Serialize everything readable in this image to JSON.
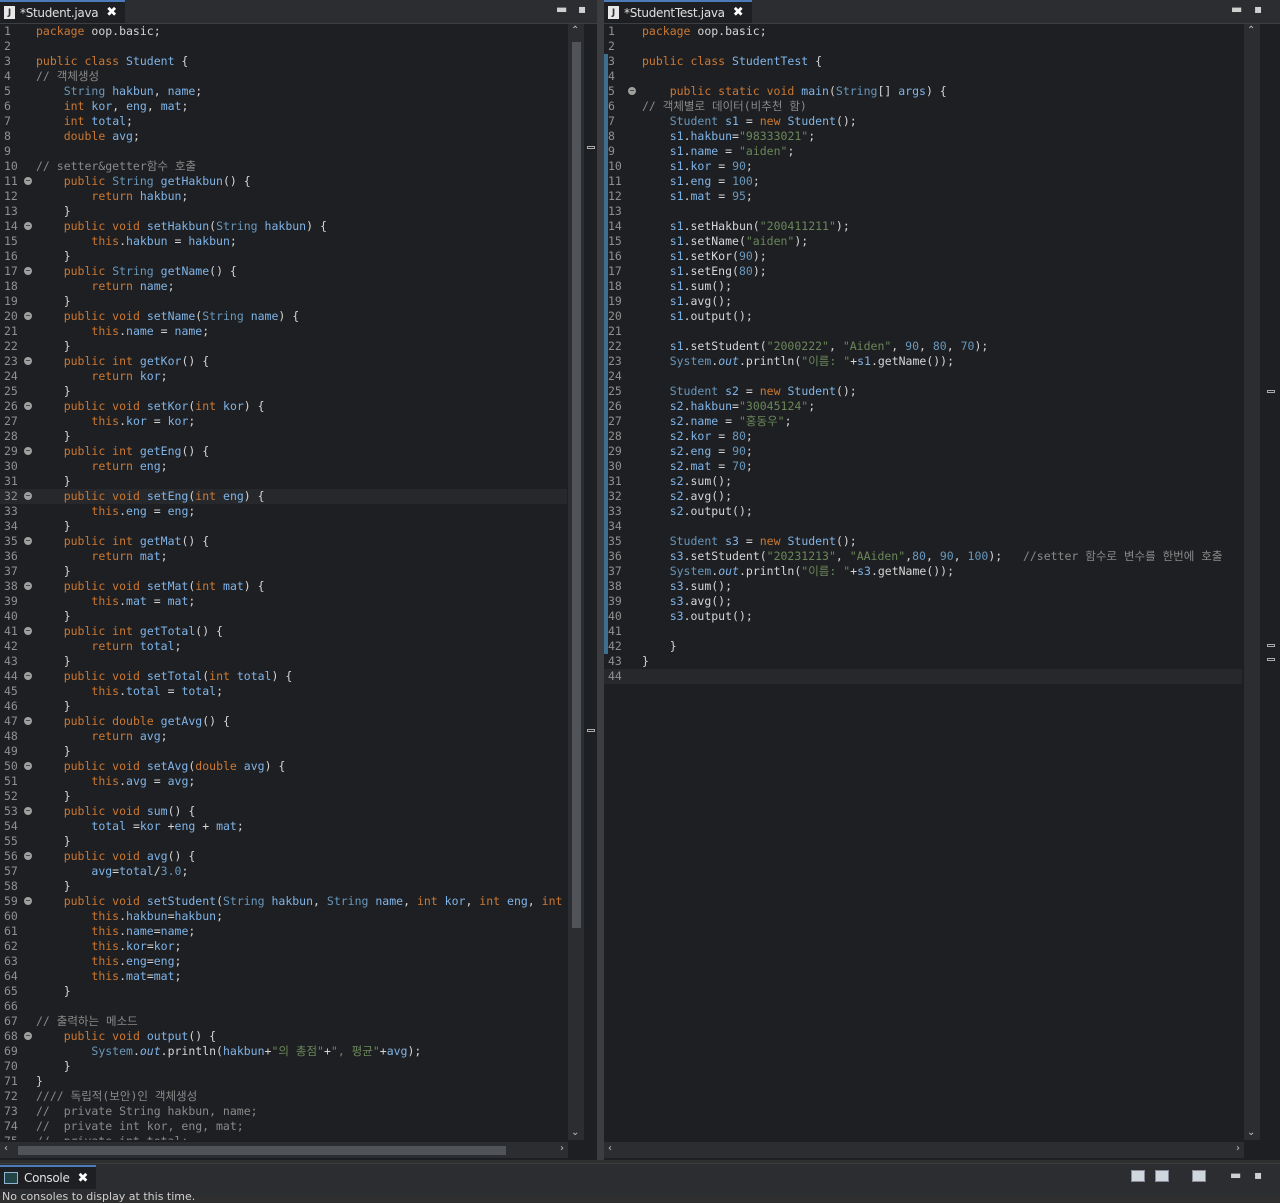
{
  "left_editor": {
    "tab_title": "*Student.java",
    "file_icon": "J",
    "lines": [
      {
        "n": "1",
        "html": "<span class='kw'>package</span> oop.basic;"
      },
      {
        "n": "2",
        "html": ""
      },
      {
        "n": "3",
        "html": "<span class='kw'>public class</span> <span class='fn'>Student</span> {"
      },
      {
        "n": "4",
        "html": "<span class='cm'>// 객체생성</span>"
      },
      {
        "n": "5",
        "html": "    <span class='ty'>String</span> <span class='fn'>hakbun</span>, <span class='fn'>name</span>;"
      },
      {
        "n": "6",
        "html": "    <span class='kw'>int</span> <span class='fn'>kor</span>, <span class='fn'>eng</span>, <span class='fn'>mat</span>;"
      },
      {
        "n": "7",
        "html": "    <span class='kw'>int</span> <span class='fn'>total</span>;"
      },
      {
        "n": "8",
        "html": "    <span class='kw'>double</span> <span class='fn'>avg</span>;"
      },
      {
        "n": "9",
        "html": ""
      },
      {
        "n": "10",
        "html": "<span class='cm'>// setter&amp;getter함수 호출</span>"
      },
      {
        "n": "11",
        "fold": true,
        "html": "    <span class='kw'>public</span> <span class='ty'>String</span> <span class='fn'>getHakbun</span>() {"
      },
      {
        "n": "12",
        "html": "        <span class='kw'>return</span> <span class='fn'>hakbun</span>;"
      },
      {
        "n": "13",
        "html": "    }"
      },
      {
        "n": "14",
        "fold": true,
        "html": "    <span class='kw'>public void</span> <span class='fn'>setHakbun</span>(<span class='ty'>String</span> <span class='fn'>hakbun</span>) {"
      },
      {
        "n": "15",
        "html": "        <span class='kw'>this</span>.<span class='fn'>hakbun</span> = <span class='fn'>hakbun</span>;"
      },
      {
        "n": "16",
        "html": "    }"
      },
      {
        "n": "17",
        "fold": true,
        "html": "    <span class='kw'>public</span> <span class='ty'>String</span> <span class='fn'>getName</span>() {"
      },
      {
        "n": "18",
        "html": "        <span class='kw'>return</span> <span class='fn'>name</span>;"
      },
      {
        "n": "19",
        "html": "    }"
      },
      {
        "n": "20",
        "fold": true,
        "html": "    <span class='kw'>public void</span> <span class='fn'>setName</span>(<span class='ty'>String</span> <span class='fn'>name</span>) {"
      },
      {
        "n": "21",
        "html": "        <span class='kw'>this</span>.<span class='fn'>name</span> = <span class='fn'>name</span>;"
      },
      {
        "n": "22",
        "html": "    }"
      },
      {
        "n": "23",
        "fold": true,
        "html": "    <span class='kw'>public int</span> <span class='fn'>getKor</span>() {"
      },
      {
        "n": "24",
        "html": "        <span class='kw'>return</span> <span class='fn'>kor</span>;"
      },
      {
        "n": "25",
        "html": "    }"
      },
      {
        "n": "26",
        "fold": true,
        "html": "    <span class='kw'>public void</span> <span class='fn'>setKor</span>(<span class='kw'>int</span> <span class='fn'>kor</span>) {"
      },
      {
        "n": "27",
        "html": "        <span class='kw'>this</span>.<span class='fn'>kor</span> = <span class='fn'>kor</span>;"
      },
      {
        "n": "28",
        "html": "    }"
      },
      {
        "n": "29",
        "fold": true,
        "html": "    <span class='kw'>public int</span> <span class='fn'>getEng</span>() {"
      },
      {
        "n": "30",
        "html": "        <span class='kw'>return</span> <span class='fn'>eng</span>;"
      },
      {
        "n": "31",
        "html": "    }"
      },
      {
        "n": "32",
        "fold": true,
        "cur": true,
        "html": "    <span class='kw'>public void</span> <span class='fn'>setEng</span>(<span class='kw'>int</span> <span class='fn'>eng</span>) {"
      },
      {
        "n": "33",
        "html": "        <span class='kw'>this</span>.<span class='fn'>eng</span> = <span class='fn'>eng</span>;"
      },
      {
        "n": "34",
        "html": "    }"
      },
      {
        "n": "35",
        "fold": true,
        "html": "    <span class='kw'>public int</span> <span class='fn'>getMat</span>() {"
      },
      {
        "n": "36",
        "html": "        <span class='kw'>return</span> <span class='fn'>mat</span>;"
      },
      {
        "n": "37",
        "html": "    }"
      },
      {
        "n": "38",
        "fold": true,
        "html": "    <span class='kw'>public void</span> <span class='fn'>setMat</span>(<span class='kw'>int</span> <span class='fn'>mat</span>) {"
      },
      {
        "n": "39",
        "html": "        <span class='kw'>this</span>.<span class='fn'>mat</span> = <span class='fn'>mat</span>;"
      },
      {
        "n": "40",
        "html": "    }"
      },
      {
        "n": "41",
        "fold": true,
        "html": "    <span class='kw'>public int</span> <span class='fn'>getTotal</span>() {"
      },
      {
        "n": "42",
        "html": "        <span class='kw'>return</span> <span class='fn'>total</span>;"
      },
      {
        "n": "43",
        "html": "    }"
      },
      {
        "n": "44",
        "fold": true,
        "html": "    <span class='kw'>public void</span> <span class='fn'>setTotal</span>(<span class='kw'>int</span> <span class='fn'>total</span>) {"
      },
      {
        "n": "45",
        "html": "        <span class='kw'>this</span>.<span class='fn'>total</span> = <span class='fn'>total</span>;"
      },
      {
        "n": "46",
        "html": "    }"
      },
      {
        "n": "47",
        "fold": true,
        "html": "    <span class='kw'>public double</span> <span class='fn'>getAvg</span>() {"
      },
      {
        "n": "48",
        "html": "        <span class='kw'>return</span> <span class='fn'>avg</span>;"
      },
      {
        "n": "49",
        "html": "    }"
      },
      {
        "n": "50",
        "fold": true,
        "html": "    <span class='kw'>public void</span> <span class='fn'>setAvg</span>(<span class='kw'>double</span> <span class='fn'>avg</span>) {"
      },
      {
        "n": "51",
        "html": "        <span class='kw'>this</span>.<span class='fn'>avg</span> = <span class='fn'>avg</span>;"
      },
      {
        "n": "52",
        "html": "    }"
      },
      {
        "n": "53",
        "fold": true,
        "html": "    <span class='kw'>public void</span> <span class='fn'>sum</span>() {"
      },
      {
        "n": "54",
        "html": "        <span class='fn'>total</span> =<span class='fn'>kor</span> +<span class='fn'>eng</span> + <span class='fn'>mat</span>;"
      },
      {
        "n": "55",
        "html": "    }"
      },
      {
        "n": "56",
        "fold": true,
        "html": "    <span class='kw'>public void</span> <span class='fn'>avg</span>() {"
      },
      {
        "n": "57",
        "html": "        <span class='fn'>avg</span>=<span class='fn'>total</span>/<span class='nu'>3.0</span>;"
      },
      {
        "n": "58",
        "html": "    }"
      },
      {
        "n": "59",
        "fold": true,
        "html": "    <span class='kw'>public void</span> <span class='fn'>setStudent</span>(<span class='ty'>String</span> <span class='fn'>hakbun</span>, <span class='ty'>String</span> <span class='fn'>name</span>, <span class='kw'>int</span> <span class='fn'>kor</span>, <span class='kw'>int</span> <span class='fn'>eng</span>, <span class='kw'>int</span>"
      },
      {
        "n": "60",
        "html": "        <span class='kw'>this</span>.<span class='fn'>hakbun</span>=<span class='fn'>hakbun</span>;"
      },
      {
        "n": "61",
        "html": "        <span class='kw'>this</span>.<span class='fn'>name</span>=<span class='fn'>name</span>;"
      },
      {
        "n": "62",
        "html": "        <span class='kw'>this</span>.<span class='fn'>kor</span>=<span class='fn'>kor</span>;"
      },
      {
        "n": "63",
        "html": "        <span class='kw'>this</span>.<span class='fn'>eng</span>=<span class='fn'>eng</span>;"
      },
      {
        "n": "64",
        "html": "        <span class='kw'>this</span>.<span class='fn'>mat</span>=<span class='fn'>mat</span>;"
      },
      {
        "n": "65",
        "html": "    }"
      },
      {
        "n": "66",
        "html": ""
      },
      {
        "n": "67",
        "html": "<span class='cm'>// 출력하는 메소드</span>"
      },
      {
        "n": "68",
        "fold": true,
        "html": "    <span class='kw'>public void</span> <span class='fn'>output</span>() {"
      },
      {
        "n": "69",
        "html": "        <span class='ty'>System</span>.<i class='fn'>out</i>.println(<span class='fn'>hakbun</span>+<span class='st'>\"의 총점\"</span>+<span class='st'>\", 평균\"</span>+<span class='fn'>avg</span>);"
      },
      {
        "n": "70",
        "html": "    }"
      },
      {
        "n": "71",
        "html": "}"
      },
      {
        "n": "72",
        "html": "<span class='cm'>//// 독립적(보안)인 객체생성</span>"
      },
      {
        "n": "73",
        "html": "<span class='cm'>//  private String hakbun, name;</span>"
      },
      {
        "n": "74",
        "html": "<span class='cm'>//  private int kor, eng, mat;</span>"
      },
      {
        "n": "75",
        "html": "<span class='cm'>//  private int total;</span>"
      }
    ]
  },
  "right_editor": {
    "tab_title": "*StudentTest.java",
    "file_icon": "J",
    "lines": [
      {
        "n": "1",
        "html": "<span class='kw'>package</span> oop.basic;"
      },
      {
        "n": "2",
        "html": ""
      },
      {
        "n": "3",
        "mark": true,
        "html": "<span class='kw'>public class</span> <span class='fn'>StudentTest</span> {"
      },
      {
        "n": "4",
        "mark": true,
        "html": ""
      },
      {
        "n": "5",
        "fold": true,
        "mark": true,
        "html": "    <span class='kw'>public static void</span> <span class='fn'>main</span>(<span class='ty'>String</span>[] <span class='fn'>args</span>) {"
      },
      {
        "n": "6",
        "mark": true,
        "html": "<span class='cm'>// 객체별로 데이터(비추천 함)</span>"
      },
      {
        "n": "7",
        "mark": true,
        "html": "    <span class='ty'>Student</span> <span class='fn'>s1</span> = <span class='kw'>new</span> <span class='fn'>Student</span>();"
      },
      {
        "n": "8",
        "mark": true,
        "html": "    <span class='fn'>s1</span>.<span class='fn'>hakbun</span>=<span class='st'>\"98333021\"</span>;"
      },
      {
        "n": "9",
        "mark": true,
        "html": "    <span class='fn'>s1</span>.<span class='fn'>name</span> = <span class='st'>\"aiden\"</span>;"
      },
      {
        "n": "10",
        "mark": true,
        "html": "    <span class='fn'>s1</span>.<span class='fn'>kor</span> = <span class='nu'>90</span>;"
      },
      {
        "n": "11",
        "mark": true,
        "html": "    <span class='fn'>s1</span>.<span class='fn'>eng</span> = <span class='nu'>100</span>;"
      },
      {
        "n": "12",
        "mark": true,
        "html": "    <span class='fn'>s1</span>.<span class='fn'>mat</span> = <span class='nu'>95</span>;"
      },
      {
        "n": "13",
        "mark": true,
        "html": ""
      },
      {
        "n": "14",
        "mark": true,
        "html": "    <span class='fn'>s1</span>.setHakbun(<span class='st'>\"200411211\"</span>);"
      },
      {
        "n": "15",
        "mark": true,
        "html": "    <span class='fn'>s1</span>.setName(<span class='st'>\"aiden\"</span>);"
      },
      {
        "n": "16",
        "mark": true,
        "html": "    <span class='fn'>s1</span>.setKor(<span class='nu'>90</span>);"
      },
      {
        "n": "17",
        "mark": true,
        "html": "    <span class='fn'>s1</span>.setEng(<span class='nu'>80</span>);"
      },
      {
        "n": "18",
        "mark": true,
        "html": "    <span class='fn'>s1</span>.sum();"
      },
      {
        "n": "19",
        "mark": true,
        "html": "    <span class='fn'>s1</span>.avg();"
      },
      {
        "n": "20",
        "mark": true,
        "html": "    <span class='fn'>s1</span>.output();"
      },
      {
        "n": "21",
        "mark": true,
        "html": ""
      },
      {
        "n": "22",
        "mark": true,
        "html": "    <span class='fn'>s1</span>.setStudent(<span class='st'>\"2000222\"</span>, <span class='st'>\"Aiden\"</span>, <span class='nu'>90</span>, <span class='nu'>80</span>, <span class='nu'>70</span>);"
      },
      {
        "n": "23",
        "mark": true,
        "html": "    <span class='ty'>System</span>.<i class='fn'>out</i>.println(<span class='st'>\"이름: \"</span>+<span class='fn'>s1</span>.getName());"
      },
      {
        "n": "24",
        "mark": true,
        "html": ""
      },
      {
        "n": "25",
        "mark": true,
        "html": "    <span class='ty'>Student</span> <span class='fn'>s2</span> = <span class='kw'>new</span> <span class='fn'>Student</span>();"
      },
      {
        "n": "26",
        "mark": true,
        "html": "    <span class='fn'>s2</span>.<span class='fn'>hakbun</span>=<span class='st'>\"30045124\"</span>;"
      },
      {
        "n": "27",
        "mark": true,
        "html": "    <span class='fn'>s2</span>.<span class='fn'>name</span> = <span class='st'>\"홍동우\"</span>;"
      },
      {
        "n": "28",
        "mark": true,
        "html": "    <span class='fn'>s2</span>.<span class='fn'>kor</span> = <span class='nu'>80</span>;"
      },
      {
        "n": "29",
        "mark": true,
        "html": "    <span class='fn'>s2</span>.<span class='fn'>eng</span> = <span class='nu'>90</span>;"
      },
      {
        "n": "30",
        "mark": true,
        "html": "    <span class='fn'>s2</span>.<span class='fn'>mat</span> = <span class='nu'>70</span>;"
      },
      {
        "n": "31",
        "mark": true,
        "html": "    <span class='fn'>s2</span>.sum();"
      },
      {
        "n": "32",
        "mark": true,
        "html": "    <span class='fn'>s2</span>.avg();"
      },
      {
        "n": "33",
        "mark": true,
        "html": "    <span class='fn'>s2</span>.output();"
      },
      {
        "n": "34",
        "mark": true,
        "html": ""
      },
      {
        "n": "35",
        "mark": true,
        "html": "    <span class='ty'>Student</span> <span class='fn'>s3</span> = <span class='kw'>new</span> <span class='fn'>Student</span>();"
      },
      {
        "n": "36",
        "mark": true,
        "html": "    <span class='fn'>s3</span>.setStudent(<span class='st'>\"20231213\"</span>, <span class='st'>\"AAiden\"</span>,<span class='nu'>80</span>, <span class='nu'>90</span>, <span class='nu'>100</span>);   <span class='cm'>//setter 함수로 변수를 한번에 호출</span>"
      },
      {
        "n": "37",
        "mark": true,
        "html": "    <span class='ty'>System</span>.<i class='fn'>out</i>.println(<span class='st'>\"이름: \"</span>+<span class='fn'>s3</span>.getName());"
      },
      {
        "n": "38",
        "mark": true,
        "html": "    <span class='fn'>s3</span>.sum();"
      },
      {
        "n": "39",
        "mark": true,
        "html": "    <span class='fn'>s3</span>.avg();"
      },
      {
        "n": "40",
        "mark": true,
        "html": "    <span class='fn'>s3</span>.output();"
      },
      {
        "n": "41",
        "mark": true,
        "html": ""
      },
      {
        "n": "42",
        "mark": true,
        "html": "    }"
      },
      {
        "n": "43",
        "html": "}"
      },
      {
        "n": "44",
        "cur": true,
        "html": ""
      }
    ]
  },
  "console": {
    "tab_title": "Console",
    "message": "No consoles to display at this time."
  },
  "icons": {
    "close": "✖",
    "minimize": "▬",
    "maximize": "▪",
    "arrow_up": "⌃",
    "arrow_down": "⌄",
    "arrow_left": "‹",
    "arrow_right": "›"
  }
}
